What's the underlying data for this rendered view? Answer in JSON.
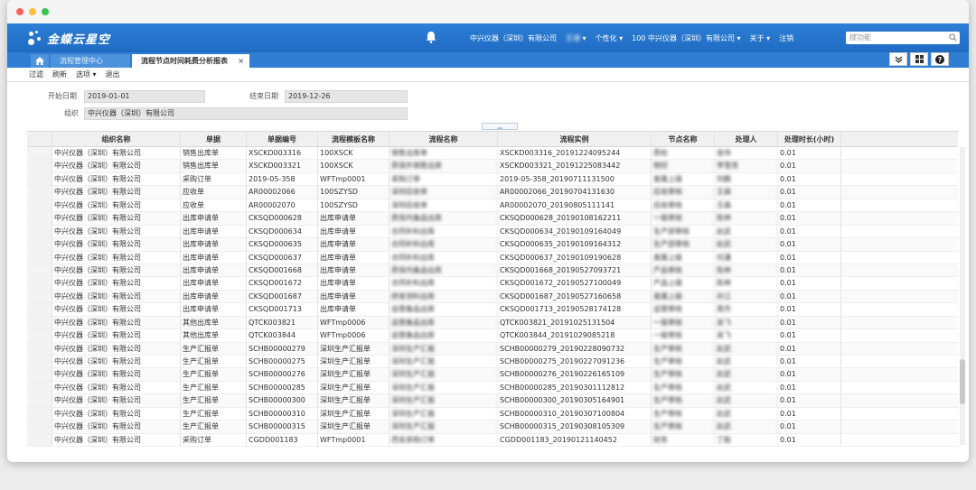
{
  "window": {
    "traffic_lights": [
      "close",
      "minimize",
      "maximize"
    ]
  },
  "header": {
    "logo_text": "金蝶云星空",
    "company": "中兴仪器（深圳）有限公司",
    "user": "王增",
    "personalize": "个性化",
    "org_code": "100",
    "org_name": "中兴仪器（深圳）有限公司",
    "about": "关于",
    "logout": "注销",
    "search_placeholder": "搜功能"
  },
  "tabs": [
    {
      "label": "流程管理中心"
    },
    {
      "label": "流程节点时间耗费分析报表"
    }
  ],
  "tab_close": "×",
  "toolbar": {
    "filter": "过滤",
    "refresh": "刷新",
    "options": "选项",
    "exit": "退出"
  },
  "filters": {
    "start_label": "开始日期",
    "start_value": "2019-01-01",
    "end_label": "结束日期",
    "end_value": "2019-12-26",
    "org_label": "组织",
    "org_value": "中兴仪器（深圳）有限公司"
  },
  "columns": [
    "组织名称",
    "单据",
    "单据编号",
    "流程模板名称",
    "流程名称",
    "流程实例",
    "节点名称",
    "处理人",
    "处理时长(小时)"
  ],
  "rows": [
    [
      "中兴仪器（深圳）有限公司",
      "销售出库单",
      "XSCKD003316",
      "100XSCK",
      "销售出库单",
      "XSCKD003316_20191224095244",
      "质检",
      "张伟",
      "0.01"
    ],
    [
      "中兴仪器（深圳）有限公司",
      "销售出库单",
      "XSCKD003321",
      "100XSCK",
      "质保外销售出库",
      "XSCKD003321_20191225083442",
      "物控",
      "李雪贤",
      "0.01"
    ],
    [
      "中兴仪器（深圳）有限公司",
      "采购订单",
      "2019-05-358",
      "WFTmp0001",
      "采购订单",
      "2019-05-358_20190711131500",
      "直属上级",
      "刘鹏",
      "0.01"
    ],
    [
      "中兴仪器（深圳）有限公司",
      "应收单",
      "AR00002066",
      "100SZYSD",
      "深圳应收单",
      "AR00002066_20190704131630",
      "应收审核",
      "王森",
      "0.01"
    ],
    [
      "中兴仪器（深圳）有限公司",
      "应收单",
      "AR00002070",
      "100SZYSD",
      "深圳应收单",
      "AR00002070_20190805111141",
      "应收审核",
      "王森",
      "0.01"
    ],
    [
      "中兴仪器（深圳）有限公司",
      "出库申请单",
      "CKSQD000628",
      "出库申请单",
      "质保内备品出库",
      "CKSQD000628_20190108162211",
      "一级审核",
      "陈林",
      "0.01"
    ],
    [
      "中兴仪器（深圳）有限公司",
      "出库申请单",
      "CKSQD000634",
      "出库申请单",
      "合同补料出库",
      "CKSQD000634_20190109164049",
      "生产部审核",
      "赵武",
      "0.01"
    ],
    [
      "中兴仪器（深圳）有限公司",
      "出库申请单",
      "CKSQD000635",
      "出库申请单",
      "合同补料出库",
      "CKSQD000635_20190109164312",
      "生产部审核",
      "赵武",
      "0.01"
    ],
    [
      "中兴仪器（深圳）有限公司",
      "出库申请单",
      "CKSQD000637",
      "出库申请单",
      "合同补料出库",
      "CKSQD000637_20190109190628",
      "直属上级",
      "何潘",
      "0.01"
    ],
    [
      "中兴仪器（深圳）有限公司",
      "出库申请单",
      "CKSQD001668",
      "出库申请单",
      "质保内备品出库",
      "CKSQD001668_20190527093721",
      "产品审核",
      "陈林",
      "0.01"
    ],
    [
      "中兴仪器（深圳）有限公司",
      "出库申请单",
      "CKSQD001672",
      "出库申请单",
      "合同补料出库",
      "CKSQD001672_20190527100049",
      "产品上级",
      "陈林",
      "0.01"
    ],
    [
      "中兴仪器（深圳）有限公司",
      "出库申请单",
      "CKSQD001687",
      "出库申请单",
      "研发领料出库",
      "CKSQD001687_20190527160658",
      "直属上级",
      "孙江",
      "0.01"
    ],
    [
      "中兴仪器（深圳）有限公司",
      "出库申请单",
      "CKSQD001713",
      "出库申请单",
      "运营备品出库",
      "CKSQD001713_20190528174128",
      "运营审核",
      "周杰",
      "0.01"
    ],
    [
      "中兴仪器（深圳）有限公司",
      "其他出库单",
      "QTCK003821",
      "WFTmp0006",
      "运营备品出库",
      "QTCK003821_20191025131504",
      "一级审核",
      "吴飞",
      "0.01"
    ],
    [
      "中兴仪器（深圳）有限公司",
      "其他出库单",
      "QTCK003844",
      "WFTmp0006",
      "运营备品出库",
      "QTCK003844_20191029085218",
      "一级审核",
      "吴飞",
      "0.01"
    ],
    [
      "中兴仪器（深圳）有限公司",
      "生产汇报单",
      "SCHB00000279",
      "深圳生产汇报单",
      "深圳生产汇报",
      "SCHB00000279_20190228090732",
      "生产审核",
      "赵武",
      "0.01"
    ],
    [
      "中兴仪器（深圳）有限公司",
      "生产汇报单",
      "SCHB00000275",
      "深圳生产汇报单",
      "深圳生产汇报",
      "SCHB00000275_20190227091236",
      "生产审核",
      "赵武",
      "0.01"
    ],
    [
      "中兴仪器（深圳）有限公司",
      "生产汇报单",
      "SCHB00000276",
      "深圳生产汇报单",
      "深圳生产汇报",
      "SCHB00000276_20190226165109",
      "生产审核",
      "赵武",
      "0.01"
    ],
    [
      "中兴仪器（深圳）有限公司",
      "生产汇报单",
      "SCHB00000285",
      "深圳生产汇报单",
      "深圳生产汇报",
      "SCHB00000285_20190301112812",
      "生产审核",
      "赵武",
      "0.01"
    ],
    [
      "中兴仪器（深圳）有限公司",
      "生产汇报单",
      "SCHB00000300",
      "深圳生产汇报单",
      "深圳生产汇报",
      "SCHB00000300_20190305164901",
      "生产审核",
      "赵武",
      "0.01"
    ],
    [
      "中兴仪器（深圳）有限公司",
      "生产汇报单",
      "SCHB00000310",
      "深圳生产汇报单",
      "深圳生产汇报",
      "SCHB00000310_20190307100804",
      "生产审核",
      "赵武",
      "0.01"
    ],
    [
      "中兴仪器（深圳）有限公司",
      "生产汇报单",
      "SCHB00000315",
      "深圳生产汇报单",
      "深圳生产汇报",
      "SCHB00000315_20190308105309",
      "生产审核",
      "赵武",
      "0.01"
    ],
    [
      "中兴仪器（深圳）有限公司",
      "采购订单",
      "CGDD001183",
      "WFTmp0001",
      "西安采购订单",
      "CGDD001183_20190121140452",
      "财务",
      "丁毅",
      "0.01"
    ]
  ]
}
